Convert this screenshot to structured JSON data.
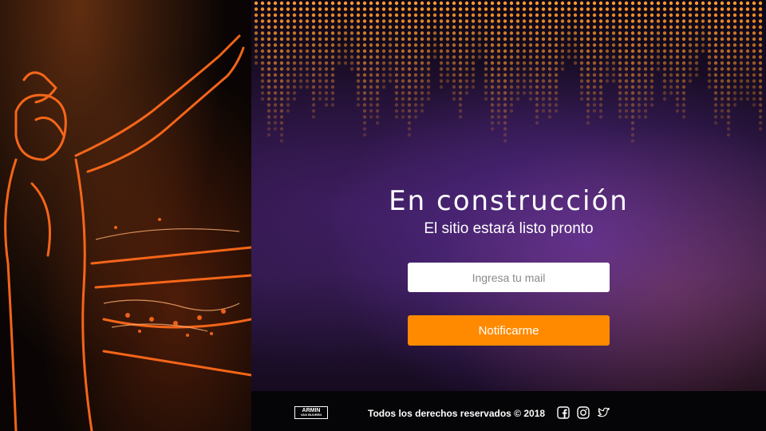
{
  "hero": {
    "title": "En construcción",
    "subtitle": "El sitio estará listo pronto"
  },
  "form": {
    "email_placeholder": "Ingresa tu mail",
    "submit_label": "Notificarme"
  },
  "footer": {
    "brand_line1": "ARMIN",
    "brand_line2": "VAN BUUREN",
    "copyright": "Todos los derechos reservados © 2018",
    "social": [
      "facebook-icon",
      "instagram-icon",
      "twitter-icon"
    ]
  },
  "colors": {
    "accent": "#ff8a00",
    "dots": "#ff9a2e",
    "neon": "#ff6a1a",
    "background": "#070509"
  }
}
